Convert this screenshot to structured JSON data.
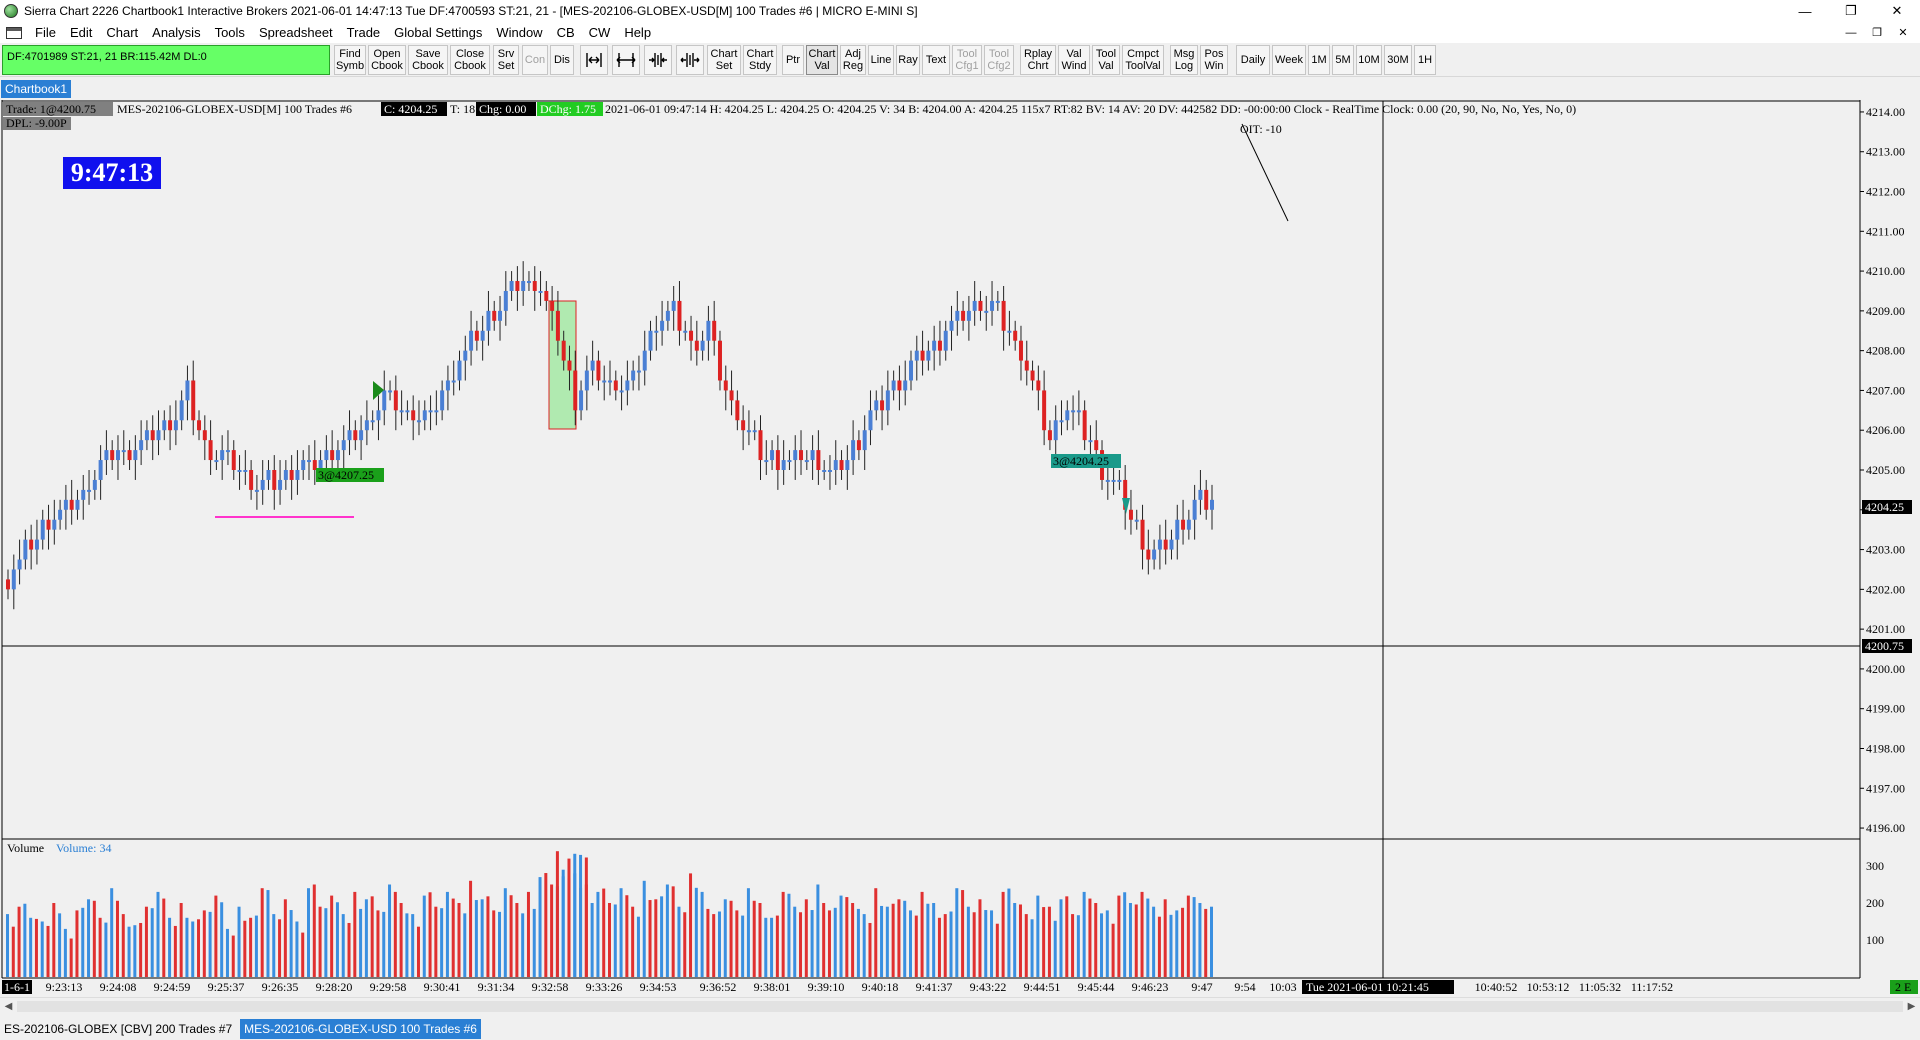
{
  "window": {
    "title": "Sierra Chart 2226 Chartbook1  Interactive Brokers 2021-06-01  14:47:13 Tue  DF:4700593  ST:21, 21 - [MES-202106-GLOBEX-USD[M]  100 Trades  #6 | MICRO E-MINI S]",
    "minimize": "—",
    "maximize": "❐",
    "close": "✕",
    "mdi_minimize": "—",
    "mdi_restore": "❐",
    "mdi_close": "✕"
  },
  "menu": [
    "File",
    "Edit",
    "Chart",
    "Analysis",
    "Tools",
    "Spreadsheet",
    "Trade",
    "Global Settings",
    "Window",
    "CB",
    "CW",
    "Help"
  ],
  "toolbar": {
    "status": "DF:4701989  ST:21, 21  BR:115.42M  DL:0",
    "buttons": [
      {
        "id": "find-symb",
        "label": [
          "Find",
          "Symb"
        ]
      },
      {
        "id": "open-cbook",
        "label": [
          "Open",
          "Cbook"
        ]
      },
      {
        "id": "save-cbook",
        "label": [
          "Save",
          "Cbook"
        ]
      },
      {
        "id": "close-cbook",
        "label": [
          "Close",
          "Cbook"
        ]
      },
      {
        "id": "srv-set",
        "label": [
          "Srv",
          "Set"
        ]
      },
      {
        "id": "con",
        "label": [
          "Con"
        ],
        "disabled": true
      },
      {
        "id": "dis",
        "label": [
          "Dis"
        ]
      },
      {
        "id": "chart-set",
        "label": [
          "Chart",
          "Set"
        ]
      },
      {
        "id": "chart-stdy",
        "label": [
          "Chart",
          "Stdy"
        ]
      },
      {
        "id": "ptr",
        "label": [
          "Ptr"
        ]
      },
      {
        "id": "chart-val",
        "label": [
          "Chart",
          "Val"
        ],
        "active": true
      },
      {
        "id": "adj-reg",
        "label": [
          "Adj",
          "Reg"
        ]
      },
      {
        "id": "line",
        "label": [
          "Line"
        ]
      },
      {
        "id": "ray",
        "label": [
          "Ray"
        ]
      },
      {
        "id": "text",
        "label": [
          "Text"
        ]
      },
      {
        "id": "tool-cfg1",
        "label": [
          "Tool",
          "Cfg1"
        ],
        "disabled": true
      },
      {
        "id": "tool-cfg2",
        "label": [
          "Tool",
          "Cfg2"
        ],
        "disabled": true
      },
      {
        "id": "rplay-chrt",
        "label": [
          "Rplay",
          "Chrt"
        ]
      },
      {
        "id": "val-wind",
        "label": [
          "Val",
          "Wind"
        ]
      },
      {
        "id": "tool-val",
        "label": [
          "Tool",
          "Val"
        ]
      },
      {
        "id": "cmpct-toolval",
        "label": [
          "Cmpct",
          "ToolVal"
        ]
      },
      {
        "id": "msg-log",
        "label": [
          "Msg",
          "Log"
        ]
      },
      {
        "id": "pos-win",
        "label": [
          "Pos",
          "Win"
        ]
      },
      {
        "id": "daily",
        "label": [
          "Daily"
        ]
      },
      {
        "id": "week",
        "label": [
          "Week"
        ]
      },
      {
        "id": "tf-1m",
        "label": [
          "1M"
        ]
      },
      {
        "id": "tf-5m",
        "label": [
          "5M"
        ]
      },
      {
        "id": "tf-10m",
        "label": [
          "10M"
        ]
      },
      {
        "id": "tf-30m",
        "label": [
          "30M"
        ]
      },
      {
        "id": "tf-1h",
        "label": [
          "1H"
        ]
      }
    ]
  },
  "chartbook_tab": "Chartbook1",
  "chart": {
    "header": {
      "trade": "Trade: 1@4200.75",
      "symbol": "MES-202106-GLOBEX-USD[M]  100 Trades  #6",
      "close": "C: 4204.25",
      "t": "T: 18",
      "chg": "Chg: 0.00",
      "dchg": "DChg: 1.75",
      "rest": "2021-06-01 09:47:14 H: 4204.25 L: 4204.25 O: 4204.25 V: 34 B: 4204.00 A: 4204.25 115x7 RT:82 BV: 14 AV: 20 DV: 442582 DD: -00:00:00  Clock - RealTime  Clock: 0.00   (20, 90, No, No, Yes, No, 0)"
    },
    "dpl": "DPL: -9.00P",
    "clock": "9:47:13",
    "oit": "OIT: -10",
    "fill_labels": [
      "3@4207.25",
      "3@4204.25"
    ],
    "last_price_label": "4204.25",
    "cursor_price_label": "4200.75",
    "volume_label": "Volume",
    "volume_value": "Volume: 34",
    "volume_ticks": [
      "300",
      "200",
      "100"
    ],
    "volume_badge": "2 E",
    "bottom_left_date": "1-6-1",
    "time_labels": [
      "9:23:13",
      "9:24:08",
      "9:24:59",
      "9:25:37",
      "9:26:35",
      "9:28:20",
      "9:29:58",
      "9:30:41",
      "9:31:34",
      "9:32:58",
      "9:33:26",
      "9:34:53",
      "9:36:52",
      "9:38:01",
      "9:39:10",
      "9:40:18",
      "9:41:37",
      "9:43:22",
      "9:44:51",
      "9:45:44",
      "9:46:23",
      "9:47",
      "9:54",
      "10:03",
      "10:40:52",
      "10:53:12",
      "11:05:32",
      "11:17:52"
    ],
    "cursor_date_label": "Tue 2021-06-01  10:21:45",
    "colors": {
      "up": "#4a7fd4",
      "down": "#dd2222",
      "vol_up": "#3a8fe0",
      "vol_down": "#e03030",
      "magenta": "#ff33cc"
    }
  },
  "chart_data": {
    "type": "bar",
    "title": "MES-202106-GLOBEX-USD[M]  100 Trades  #6",
    "ylim": [
      4195.75,
      4214.25
    ],
    "price_ticks": [
      "4214.00",
      "4213.00",
      "4212.00",
      "4211.00",
      "4210.00",
      "4209.00",
      "4208.00",
      "4207.00",
      "4206.00",
      "4205.00",
      "4204.00",
      "4203.00",
      "4202.00",
      "4201.00",
      "4200.00",
      "4199.00",
      "4198.00",
      "4197.00",
      "4196.00"
    ],
    "close_path": [
      [
        0,
        4202.3
      ],
      [
        6,
        4203.5
      ],
      [
        12,
        4204.2
      ],
      [
        16,
        4205.2
      ],
      [
        21,
        4205.5
      ],
      [
        27,
        4206.0
      ],
      [
        31,
        4206.9
      ],
      [
        34,
        4205.6
      ],
      [
        38,
        4205.3
      ],
      [
        43,
        4204.6
      ],
      [
        47,
        4204.8
      ],
      [
        53,
        4205.2
      ],
      [
        57,
        4205.5
      ],
      [
        61,
        4205.9
      ],
      [
        65,
        4206.9
      ],
      [
        68,
        4206.5
      ],
      [
        73,
        4206.3
      ],
      [
        77,
        4207.5
      ],
      [
        81,
        4208.4
      ],
      [
        84,
        4208.9
      ],
      [
        88,
        4209.7
      ],
      [
        92,
        4209.6
      ],
      [
        95,
        4208.4
      ],
      [
        98,
        4206.7
      ],
      [
        101,
        4207.6
      ],
      [
        104,
        4207.2
      ],
      [
        108,
        4207.2
      ],
      [
        112,
        4208.7
      ],
      [
        115,
        4209.1
      ],
      [
        118,
        4208.1
      ],
      [
        121,
        4208.6
      ],
      [
        124,
        4206.9
      ],
      [
        127,
        4206.1
      ],
      [
        131,
        4205.3
      ],
      [
        135,
        4205.2
      ],
      [
        139,
        4205.4
      ],
      [
        142,
        4204.8
      ],
      [
        146,
        4205.5
      ],
      [
        150,
        4206.6
      ],
      [
        154,
        4207.3
      ],
      [
        158,
        4207.8
      ],
      [
        162,
        4208.5
      ],
      [
        166,
        4209.1
      ],
      [
        170,
        4209.2
      ],
      [
        174,
        4208.2
      ],
      [
        177,
        4207.2
      ],
      [
        180,
        4205.8
      ],
      [
        183,
        4206.7
      ],
      [
        186,
        4205.9
      ],
      [
        189,
        4205.1
      ],
      [
        192,
        4204.4
      ],
      [
        195,
        4203.5
      ],
      [
        197,
        4202.8
      ],
      [
        200,
        4203.2
      ],
      [
        203,
        4203.7
      ],
      [
        206,
        4204.3
      ],
      [
        208,
        4204.25
      ]
    ],
    "volume": [
      [
        0,
        170,
        1
      ],
      [
        2,
        190,
        0
      ],
      [
        4,
        160,
        1
      ],
      [
        6,
        150,
        1
      ],
      [
        8,
        200,
        0
      ],
      [
        10,
        130,
        1
      ],
      [
        12,
        180,
        0
      ],
      [
        14,
        210,
        1
      ],
      [
        16,
        160,
        0
      ],
      [
        18,
        240,
        1
      ],
      [
        20,
        170,
        0
      ],
      [
        22,
        140,
        1
      ],
      [
        24,
        190,
        0
      ],
      [
        26,
        230,
        1
      ],
      [
        28,
        160,
        1
      ],
      [
        30,
        200,
        0
      ],
      [
        32,
        150,
        1
      ],
      [
        34,
        180,
        0
      ],
      [
        36,
        220,
        0
      ],
      [
        38,
        130,
        1
      ],
      [
        40,
        190,
        1
      ],
      [
        42,
        160,
        0
      ],
      [
        44,
        240,
        0
      ],
      [
        46,
        170,
        1
      ],
      [
        48,
        210,
        0
      ],
      [
        50,
        150,
        1
      ],
      [
        52,
        240,
        1
      ],
      [
        54,
        190,
        0
      ],
      [
        56,
        220,
        0
      ],
      [
        58,
        170,
        1
      ],
      [
        60,
        230,
        0
      ],
      [
        62,
        210,
        1
      ],
      [
        64,
        180,
        0
      ],
      [
        66,
        250,
        1
      ],
      [
        68,
        200,
        0
      ],
      [
        70,
        170,
        1
      ],
      [
        72,
        220,
        1
      ],
      [
        74,
        190,
        0
      ],
      [
        76,
        230,
        1
      ],
      [
        78,
        200,
        0
      ],
      [
        80,
        260,
        0
      ],
      [
        82,
        210,
        1
      ],
      [
        84,
        180,
        0
      ],
      [
        86,
        240,
        1
      ],
      [
        88,
        200,
        0
      ],
      [
        90,
        230,
        0
      ],
      [
        92,
        270,
        1
      ],
      [
        94,
        250,
        0
      ],
      [
        95,
        340,
        0
      ],
      [
        96,
        290,
        1
      ],
      [
        97,
        320,
        0
      ],
      [
        98,
        280,
        1
      ],
      [
        99,
        330,
        1
      ],
      [
        100,
        250,
        0
      ],
      [
        102,
        230,
        1
      ],
      [
        104,
        200,
        0
      ],
      [
        106,
        240,
        1
      ],
      [
        108,
        190,
        0
      ],
      [
        110,
        260,
        1
      ],
      [
        112,
        210,
        0
      ],
      [
        114,
        250,
        1
      ],
      [
        116,
        190,
        1
      ],
      [
        118,
        280,
        0
      ],
      [
        120,
        230,
        1
      ],
      [
        122,
        170,
        0
      ],
      [
        124,
        210,
        1
      ],
      [
        126,
        180,
        0
      ],
      [
        128,
        240,
        1
      ],
      [
        130,
        200,
        0
      ],
      [
        132,
        160,
        1
      ],
      [
        134,
        230,
        0
      ],
      [
        136,
        190,
        1
      ],
      [
        138,
        210,
        0
      ],
      [
        140,
        250,
        1
      ],
      [
        142,
        180,
        0
      ],
      [
        144,
        220,
        1
      ],
      [
        146,
        200,
        0
      ],
      [
        148,
        170,
        1
      ],
      [
        150,
        240,
        0
      ],
      [
        152,
        190,
        1
      ],
      [
        154,
        210,
        0
      ],
      [
        156,
        180,
        1
      ],
      [
        158,
        230,
        0
      ],
      [
        160,
        200,
        1
      ],
      [
        162,
        170,
        0
      ],
      [
        164,
        240,
        1
      ],
      [
        166,
        190,
        1
      ],
      [
        168,
        210,
        0
      ],
      [
        170,
        180,
        1
      ],
      [
        172,
        230,
        0
      ],
      [
        174,
        200,
        1
      ],
      [
        176,
        170,
        0
      ],
      [
        178,
        220,
        1
      ],
      [
        180,
        190,
        0
      ],
      [
        182,
        210,
        1
      ],
      [
        184,
        170,
        0
      ],
      [
        186,
        230,
        1
      ],
      [
        188,
        200,
        0
      ],
      [
        190,
        180,
        1
      ],
      [
        192,
        220,
        0
      ],
      [
        194,
        200,
        1
      ],
      [
        196,
        230,
        0
      ],
      [
        198,
        190,
        1
      ],
      [
        200,
        210,
        0
      ],
      [
        202,
        180,
        1
      ],
      [
        204,
        220,
        0
      ],
      [
        206,
        200,
        1
      ],
      [
        208,
        190,
        1
      ]
    ]
  }
}
